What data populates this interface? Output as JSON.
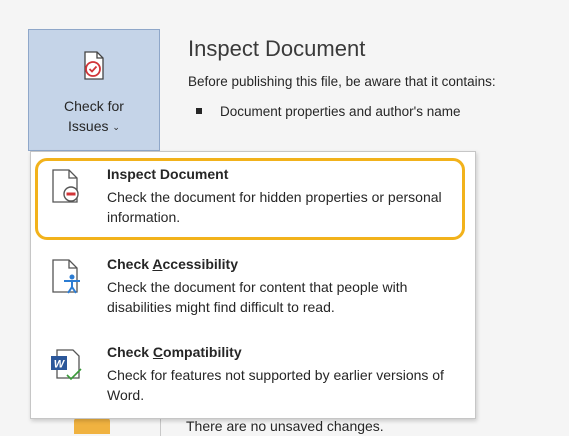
{
  "check_button": {
    "label_line1": "Check for",
    "label_line2": "Issues",
    "chevron": "⌄",
    "icon": "document-check-icon"
  },
  "section": {
    "title": "Inspect Document",
    "description": "Before publishing this file, be aware that it contains:",
    "bullets": [
      "Document properties and author's name"
    ]
  },
  "menu": {
    "items": [
      {
        "title": "Inspect Document",
        "description": "Check the document for hidden properties or personal information.",
        "icon": "inspect-document-icon"
      },
      {
        "title_before": "Check ",
        "title_underlined": "A",
        "title_after": "ccessibility",
        "description": "Check the document for content that people with disabilities might find difficult to read.",
        "icon": "accessibility-icon"
      },
      {
        "title_before": "Check ",
        "title_underlined": "C",
        "title_after": "ompatibility",
        "description": "Check for features not supported by earlier versions of Word.",
        "icon": "word-compatibility-icon"
      }
    ]
  },
  "bottom": {
    "text": "There are no unsaved changes."
  },
  "colors": {
    "button_bg": "#c5d4e8",
    "highlight": "#f2b21b",
    "icon_red": "#d13438",
    "icon_blue": "#2b7cd3"
  }
}
